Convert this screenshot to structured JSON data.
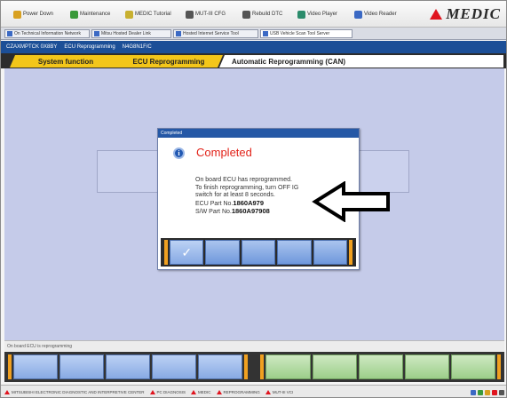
{
  "launcher": {
    "items": [
      {
        "label": "Power Down",
        "icon": "power-icon",
        "color": "#d8a020"
      },
      {
        "label": "Maintenance",
        "icon": "wrench-icon",
        "color": "#3a9a3a"
      },
      {
        "label": "MEDIC Tutorial",
        "icon": "tutorial-icon",
        "color": "#c8b030"
      },
      {
        "label": "MUT-III CFG",
        "icon": "cfg-icon",
        "color": "#555555"
      },
      {
        "label": "Rebuild DTC",
        "icon": "dtc-icon",
        "color": "#555555"
      },
      {
        "label": "Video Player",
        "icon": "video-icon",
        "color": "#2c8c6c"
      },
      {
        "label": "Video Reader",
        "icon": "reader-icon",
        "color": "#3b69c4"
      }
    ],
    "brand": "MEDIC"
  },
  "window_tabs": [
    "On Technical Information Network",
    "Mitsu Hosted Dealer Link",
    "Hosted Internet Service Tool",
    "USB Vehicle Scan Tool Server"
  ],
  "breadcrumb": [
    "CZAXMPTCK 0X8BY",
    "ECU Reprogramming",
    "N4G8N1F/C"
  ],
  "func_tabs": {
    "system_function": "System function",
    "ecu_reprogramming": "ECU Reprogramming",
    "automatic": "Automatic Reprogramming (CAN)"
  },
  "dialog": {
    "title": "Completed",
    "icon": "info-icon",
    "heading": "Completed",
    "lines": [
      "On board ECU has reprogrammed.",
      "To finish reprogramming, turn OFF IG",
      "switch for at least 8 seconds."
    ],
    "ecu_label": "ECU Part No.",
    "ecu_value": "1860A979",
    "sw_label": "S/W Part No.",
    "sw_value": "1860A97908",
    "ok_icon": "checkmark-icon"
  },
  "status_line": "On board ECU is reprogramming",
  "taskbar": [
    "MITSUBISHI ELECTRONIC DIAGNOSTIC AND INTERPRETIVE CENTER",
    "PC DIAGNOSIS",
    "MEDIC",
    "REPROGRAMMING",
    "MUT-III VCI"
  ],
  "colors": {
    "tab_accent": "#f3c61a",
    "heading_red": "#e2231a",
    "arrow": "#ffffff"
  }
}
